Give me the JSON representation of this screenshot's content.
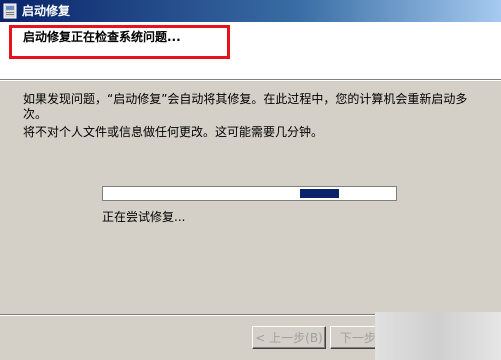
{
  "window": {
    "title": "启动修复"
  },
  "header": {
    "title": "启动修复正在检查系统问题..."
  },
  "main": {
    "paragraph1": "如果发现问题，“启动修复”会自动将其修复。在此过程中，您的计算机会重新启动多次。",
    "paragraph2": "将不对个人文件或信息做任何更改。这可能需要几分钟。"
  },
  "progress": {
    "label": "正在尝试修复..."
  },
  "buttons": {
    "back_label": "< 上一步(B)",
    "next_label": "下一步(N)"
  },
  "colors": {
    "title_bar": "#0a246a",
    "highlight_border": "#e8121e",
    "progress_chunk": "#0a246a"
  }
}
